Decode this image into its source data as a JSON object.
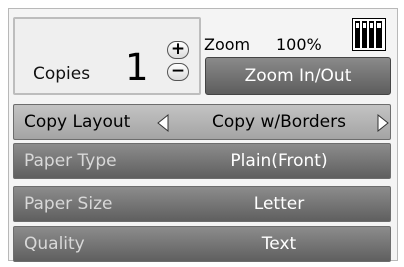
{
  "copies": {
    "label": "Copies",
    "value": "1",
    "increase_symbol": "+",
    "decrease_symbol": "−"
  },
  "zoom": {
    "label": "Zoom",
    "value": "100%",
    "button_label": "Zoom In/Out"
  },
  "ink_icon": "ink-cartridges-icon",
  "rows": {
    "layout": {
      "label": "Copy Layout",
      "value": "Copy w/Borders",
      "left_arrow_icon": "arrow-left-icon",
      "right_arrow_icon": "arrow-right-icon"
    },
    "paper_type": {
      "label": "Paper Type",
      "value": "Plain(Front)"
    },
    "paper_size": {
      "label": "Paper Size",
      "value": "Letter"
    },
    "quality": {
      "label": "Quality",
      "value": "Text"
    }
  },
  "colors": {
    "dark_row": "#6e6e6e",
    "light_row": "#b3b3b3",
    "zoom_button": "#707070"
  }
}
